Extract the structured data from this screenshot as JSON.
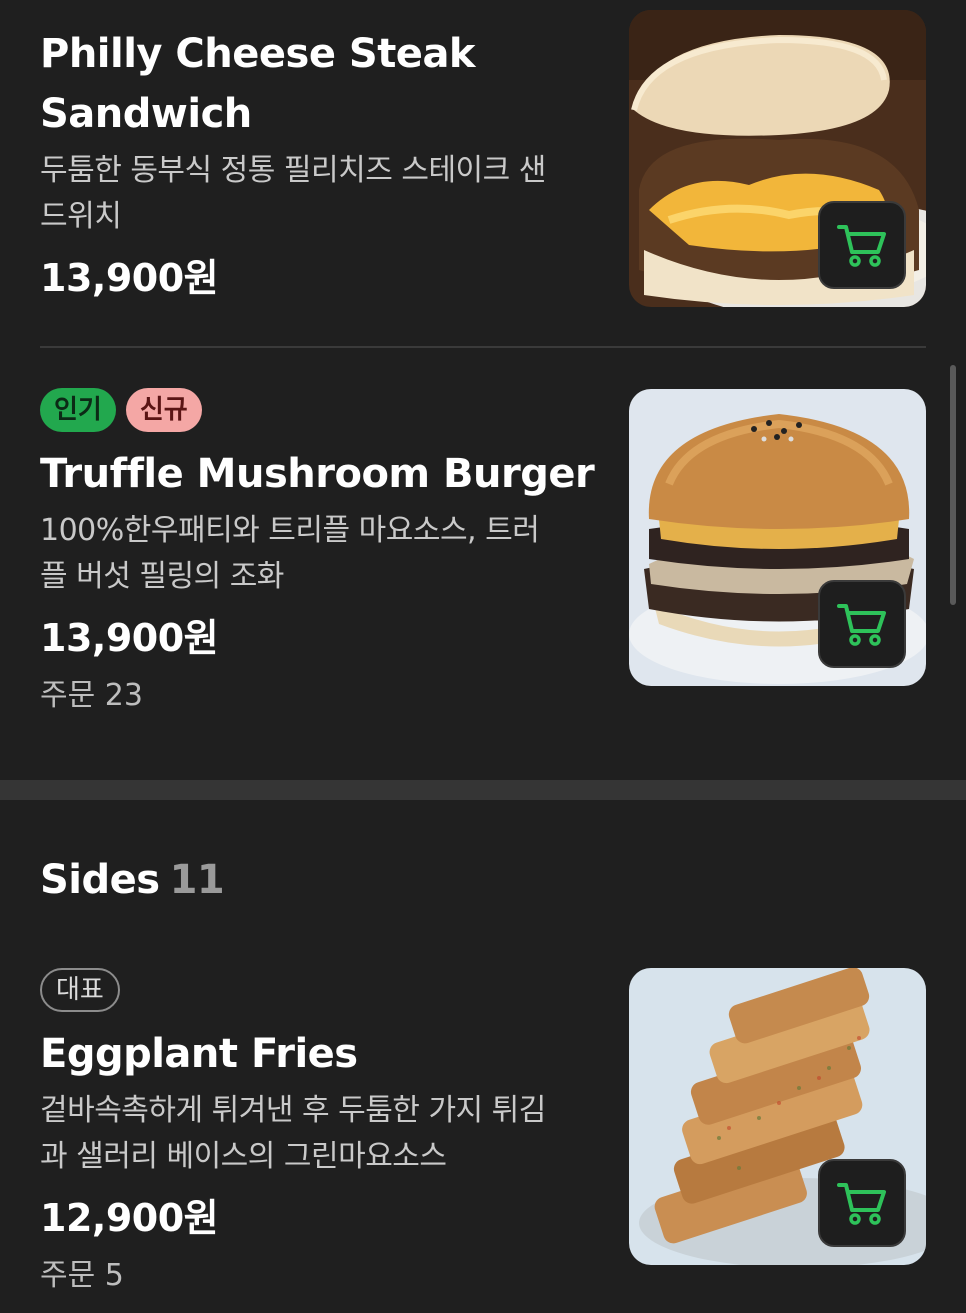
{
  "items": [
    {
      "title_line1": "Philly Cheese Steak",
      "title_line2": "Sandwich",
      "desc_line1": "두툼한 동부식 정통 필리치즈 스테이크 샌",
      "desc_line2": "드위치",
      "price": "13,900원"
    },
    {
      "badges": [
        "인기",
        "신규"
      ],
      "title_line1": "Truffle Mushroom Burger",
      "desc_line1": "100%한우패티와 트리플 마요소스, 트러",
      "desc_line2": "플 버섯 필링의 조화",
      "price": "13,900원",
      "orders": "주문 23"
    }
  ],
  "sides_section": {
    "title": "Sides",
    "count": "11",
    "items": [
      {
        "badges": [
          "대표"
        ],
        "title_line1": "Eggplant Fries",
        "desc_line1": "겉바속촉하게 튀겨낸 후 두툼한 가지 튀김",
        "desc_line2": "과 샐러리 베이스의 그린마요소스",
        "price": "12,900원",
        "orders": "주문 5"
      }
    ]
  },
  "colors": {
    "background": "#1f1f1f",
    "cart_icon": "#2ec25a",
    "badge_popular": "#22a84e",
    "badge_new": "#f4a7a5"
  },
  "icons": {
    "cart": "cart-icon"
  }
}
